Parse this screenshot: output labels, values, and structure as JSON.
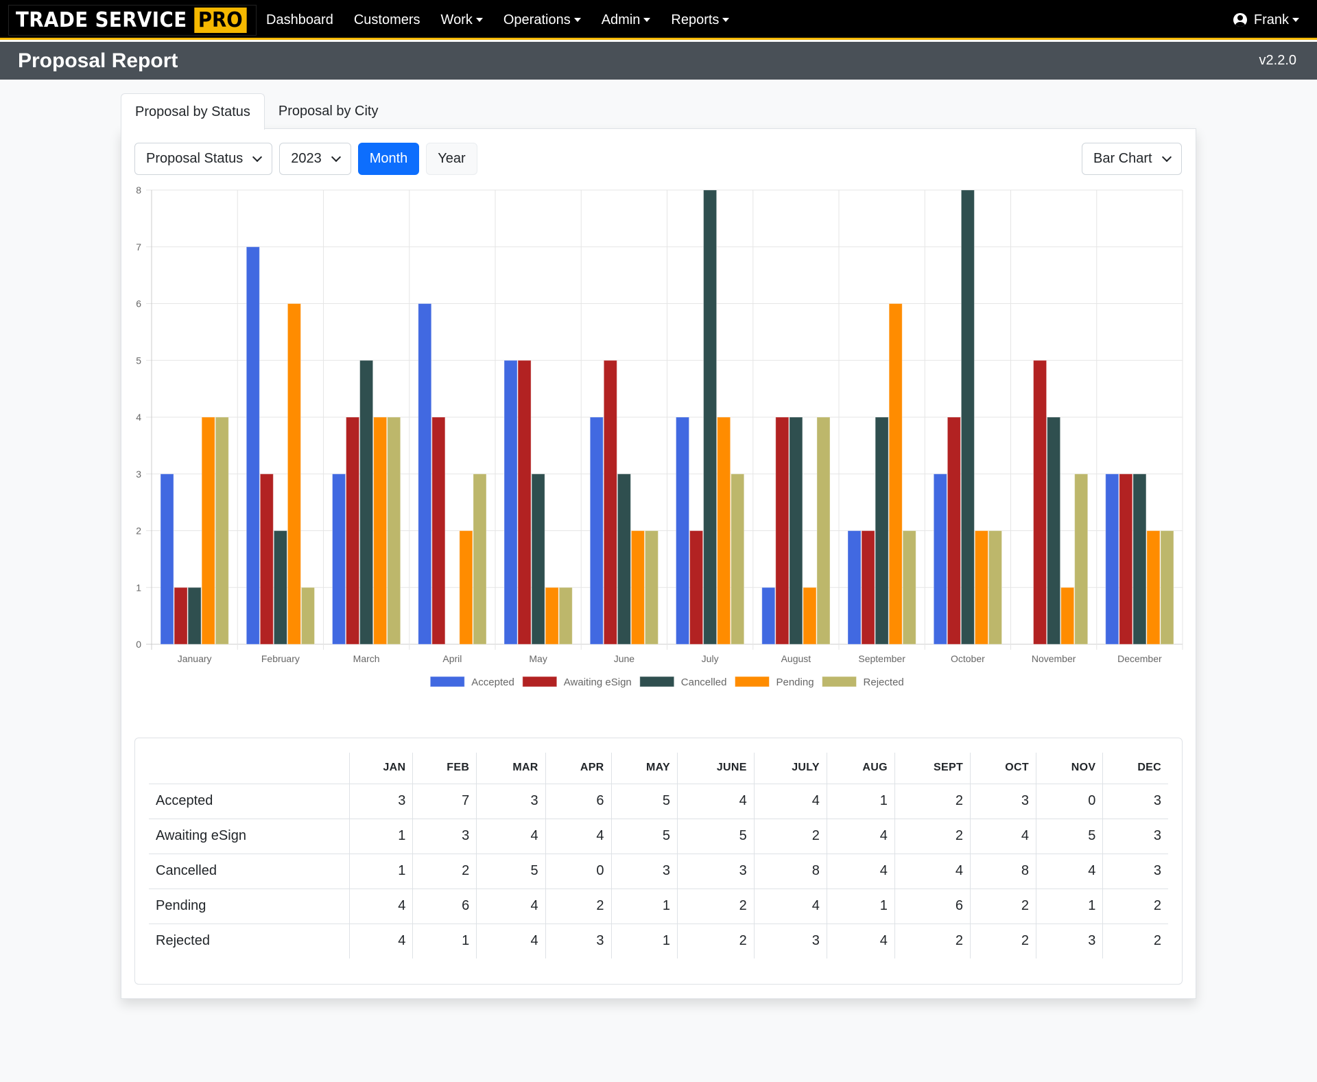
{
  "nav": {
    "brand": "TRADE SERVICE",
    "brand_badge": "PRO",
    "links": [
      {
        "label": "Dashboard",
        "dropdown": false
      },
      {
        "label": "Customers",
        "dropdown": false
      },
      {
        "label": "Work",
        "dropdown": true
      },
      {
        "label": "Operations",
        "dropdown": true
      },
      {
        "label": "Admin",
        "dropdown": true
      },
      {
        "label": "Reports",
        "dropdown": true
      }
    ],
    "user": "Frank",
    "user_icon": "user-circle-icon"
  },
  "header": {
    "title": "Proposal Report",
    "version": "v2.2.0"
  },
  "tabs": [
    {
      "label": "Proposal by Status",
      "active": true
    },
    {
      "label": "Proposal by City",
      "active": false
    }
  ],
  "controls": {
    "group_select": "Proposal Status",
    "year_select": "2023",
    "month_button": "Month",
    "year_button": "Year",
    "chart_type_select": "Bar Chart"
  },
  "colors": {
    "accent": "#f5b800",
    "primary": "#0d6efd"
  },
  "chart_data": {
    "type": "bar",
    "title": "",
    "xlabel": "",
    "ylabel": "",
    "ylim": [
      0,
      8
    ],
    "yticks": [
      0,
      1,
      2,
      3,
      4,
      5,
      6,
      7,
      8
    ],
    "grid": true,
    "legend_position": "bottom",
    "categories": [
      "January",
      "February",
      "March",
      "April",
      "May",
      "June",
      "July",
      "August",
      "September",
      "October",
      "November",
      "December"
    ],
    "series": [
      {
        "name": "Accepted",
        "color": "#4169e1",
        "values": [
          3,
          7,
          3,
          6,
          5,
          4,
          4,
          1,
          2,
          3,
          0,
          3
        ]
      },
      {
        "name": "Awaiting eSign",
        "color": "#b22222",
        "values": [
          1,
          3,
          4,
          4,
          5,
          5,
          2,
          4,
          2,
          4,
          5,
          3
        ]
      },
      {
        "name": "Cancelled",
        "color": "#2f4f4f",
        "values": [
          1,
          2,
          5,
          0,
          3,
          3,
          8,
          4,
          4,
          8,
          4,
          3
        ]
      },
      {
        "name": "Pending",
        "color": "#ff8c00",
        "values": [
          4,
          6,
          4,
          2,
          1,
          2,
          4,
          1,
          6,
          2,
          1,
          2
        ]
      },
      {
        "name": "Rejected",
        "color": "#bdb76b",
        "values": [
          4,
          1,
          4,
          3,
          1,
          2,
          3,
          4,
          2,
          2,
          3,
          2
        ]
      }
    ]
  },
  "table": {
    "columns": [
      "JAN",
      "FEB",
      "MAR",
      "APR",
      "MAY",
      "JUNE",
      "JULY",
      "AUG",
      "SEPT",
      "OCT",
      "NOV",
      "DEC"
    ],
    "rows": [
      {
        "label": "Accepted",
        "values": [
          "3",
          "7",
          "3",
          "6",
          "5",
          "4",
          "4",
          "1",
          "2",
          "3",
          "0",
          "3"
        ]
      },
      {
        "label": "Awaiting eSign",
        "values": [
          "1",
          "3",
          "4",
          "4",
          "5",
          "5",
          "2",
          "4",
          "2",
          "4",
          "5",
          "3"
        ]
      },
      {
        "label": "Cancelled",
        "values": [
          "1",
          "2",
          "5",
          "0",
          "3",
          "3",
          "8",
          "4",
          "4",
          "8",
          "4",
          "3"
        ]
      },
      {
        "label": "Pending",
        "values": [
          "4",
          "6",
          "4",
          "2",
          "1",
          "2",
          "4",
          "1",
          "6",
          "2",
          "1",
          "2"
        ]
      },
      {
        "label": "Rejected",
        "values": [
          "4",
          "1",
          "4",
          "3",
          "1",
          "2",
          "3",
          "4",
          "2",
          "2",
          "3",
          "2"
        ]
      }
    ]
  }
}
